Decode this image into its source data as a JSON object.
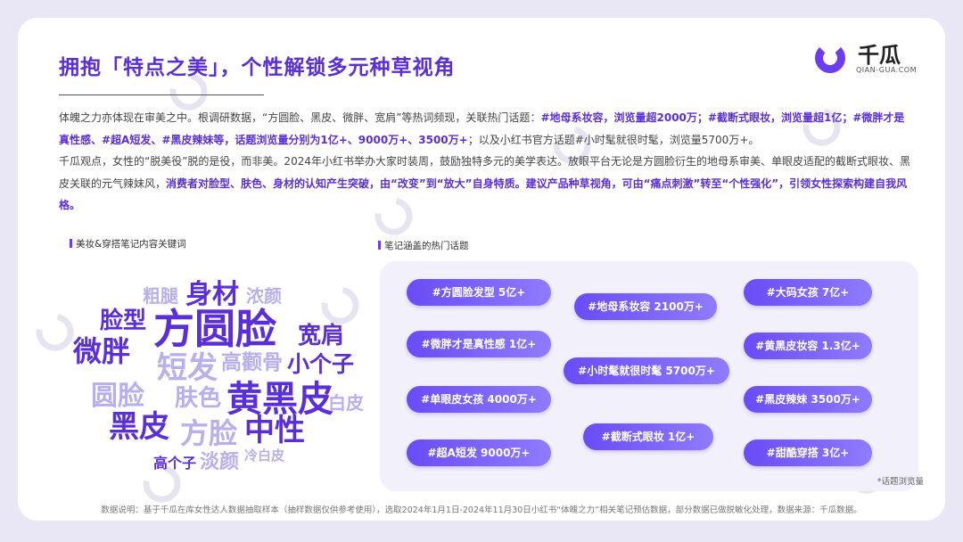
{
  "title": "拥抱「特点之美」，个性解锁多元种草视角",
  "logo": {
    "name": "千瓜",
    "domain": "QIAN-GUA.COM"
  },
  "paragraph1": {
    "p1": "体魄之力亦体现在审美之中。根调研数据，“方圆脸、黑皮、微胖、宽肩”等热词频现，关联热门话题：",
    "h1": "#地母系妆容，浏览量超2000万；#截断式眼妆，浏览量超1亿；#微胖才是真性感、#超A短发、#黑皮辣妹等，话题浏览量分别为1亿+、9000万+、3500万+",
    "p2": "；以及小红书官方话题#小时髦就很时髦，浏览量5700万+。"
  },
  "paragraph2": {
    "p1": "千瓜观点，女性的“脱美役”脱的是役，而非美。2024年小红书举办大家时装周，鼓励独特多元的美学表达。放眼平台无论是方圆脸衍生的地母系审美、单眼皮适配的截断式眼妆、黑皮关联的元气辣妹风，",
    "h1": "消费者对脸型、肤色、身材的认知产生突破，由“改变”到“放大”自身特质。建议产品种草视角，可由“痛点刺激”转至“个性强化”，引领女性探索构建自我风格。"
  },
  "wordcloud_label": "美妆&穿搭笔记内容关键词",
  "wordcloud": [
    {
      "text": "身材",
      "color": "#5b2fd8"
    },
    {
      "text": "粗腿",
      "color": "#b8b0ec"
    },
    {
      "text": "浓颜",
      "color": "#b8b0ec"
    },
    {
      "text": "脸型",
      "color": "#5b2fd8"
    },
    {
      "text": "方圆脸",
      "color": "#5b2fd8"
    },
    {
      "text": "宽肩",
      "color": "#5b2fd8"
    },
    {
      "text": "微胖",
      "color": "#5b2fd8"
    },
    {
      "text": "短发",
      "color": "#b8b0ec"
    },
    {
      "text": "高颧骨",
      "color": "#b8b0ec"
    },
    {
      "text": "小个子",
      "color": "#5b2fd8"
    },
    {
      "text": "圆脸",
      "color": "#b8b0ec"
    },
    {
      "text": "肤色",
      "color": "#b8b0ec"
    },
    {
      "text": "黄黑皮",
      "color": "#5b2fd8"
    },
    {
      "text": "白皮",
      "color": "#b8b0ec"
    },
    {
      "text": "黑皮",
      "color": "#5b2fd8"
    },
    {
      "text": "方脸",
      "color": "#b8b0ec"
    },
    {
      "text": "中性",
      "color": "#5b2fd8"
    },
    {
      "text": "高个子",
      "color": "#5b2fd8"
    },
    {
      "text": "淡颜",
      "color": "#b8b0ec"
    },
    {
      "text": "冷白皮",
      "color": "#b8b0ec"
    }
  ],
  "topics_label": "笔记涵盖的热门话题",
  "topics": [
    "#方圆脸发型 5亿+",
    "#地母系妆容 2100万+",
    "#大码女孩 7亿+",
    "#微胖才是真性感 1亿+",
    "#小时髦就很时髦 5700万+",
    "#黄黑皮妆容 1.3亿+",
    "#单眼皮女孩 4000万+",
    "#黑皮辣妹 3500万+",
    "#截断式眼妆 1亿+",
    "#超A短发 9000万+",
    "#甜酷穿搭 3亿+"
  ],
  "topics_note": "*话题浏览量",
  "footer": "数据说明：基于千瓜在库女性达人数据抽取样本（抽样数据仅供参考使用），选取2024年1月1日-2024年11月30日小红书“体魄之力”相关笔记预估数据，部分数据已做脱敏化处理，数据来源：千瓜数据。",
  "colors": {
    "accent": "#5b2fd8",
    "light": "#b8b0ec",
    "pill": "#6a4cf5"
  }
}
